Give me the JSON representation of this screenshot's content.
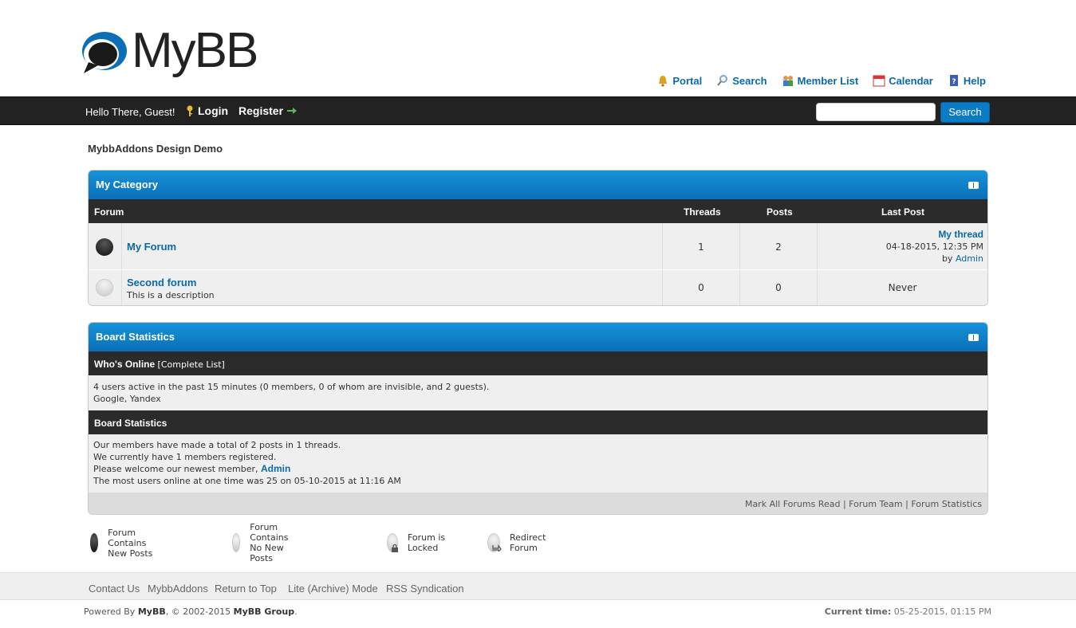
{
  "logo": {
    "text": "MyBB"
  },
  "toplinks": [
    {
      "label": "Portal",
      "icon": "bell-icon"
    },
    {
      "label": "Search",
      "icon": "magnifier-icon"
    },
    {
      "label": "Member List",
      "icon": "members-icon"
    },
    {
      "label": "Calendar",
      "icon": "calendar-icon"
    },
    {
      "label": "Help",
      "icon": "help-book-icon"
    }
  ],
  "panel": {
    "welcome": "Hello There, Guest!",
    "login": "Login",
    "register": "Register",
    "search_button": "Search",
    "search_value": ""
  },
  "breadcrumb": "MybbAddons Design Demo",
  "category": {
    "title": "My Category",
    "columns": {
      "forum": "Forum",
      "threads": "Threads",
      "posts": "Posts",
      "last_post": "Last Post"
    },
    "forums": [
      {
        "name": "My Forum",
        "description": "",
        "threads": "1",
        "posts": "2",
        "status": "new",
        "last_post": {
          "thread": "My thread",
          "date": "04-18-2015, 12:35 PM",
          "by": "by",
          "user": "Admin"
        }
      },
      {
        "name": "Second forum",
        "description": "This is a description",
        "threads": "0",
        "posts": "0",
        "status": "no-new",
        "last_post": {
          "text": "Never"
        }
      }
    ]
  },
  "stats": {
    "title": "Board Statistics",
    "whos_online": {
      "label": "Who's Online",
      "link": "[Complete List]",
      "line1": "4 users active in the past 15 minutes (0 members, 0 of whom are invisible, and 2 guests).",
      "line2": "Google, Yandex"
    },
    "board": {
      "label": "Board Statistics",
      "line1": "Our members have made a total of 2 posts in 1 threads.",
      "line2": "We currently have 1 members registered.",
      "line3_prefix": "Please welcome our newest member,",
      "newest_member": "Admin",
      "line4": "The most users online at one time was 25 on 05-10-2015 at 11:16 AM"
    },
    "footer_links": {
      "mark_read": "Mark All Forums Read",
      "sep1": "|",
      "team": "Forum Team",
      "sep2": "|",
      "statistics": "Forum Statistics"
    }
  },
  "legend": [
    {
      "label": "Forum Contains New Posts"
    },
    {
      "label": "Forum Contains No New Posts"
    },
    {
      "label": "Forum is Locked"
    },
    {
      "label": "Redirect Forum"
    }
  ],
  "footer": {
    "links": [
      "Contact Us",
      "MybbAddons",
      "Return to Top",
      "Lite (Archive) Mode",
      "RSS Syndication"
    ],
    "powered_prefix": "Powered By",
    "powered_mybb": "MyBB",
    "copyright_mid": ", © 2002-2015",
    "powered_group": "MyBB Group",
    "period": ".",
    "current_time_label": "Current time:",
    "current_time": "05-25-2015, 01:15 PM"
  },
  "colors": {
    "accent": "#0b6fb7",
    "bar": "#222222",
    "link": "#0a6aa8"
  }
}
